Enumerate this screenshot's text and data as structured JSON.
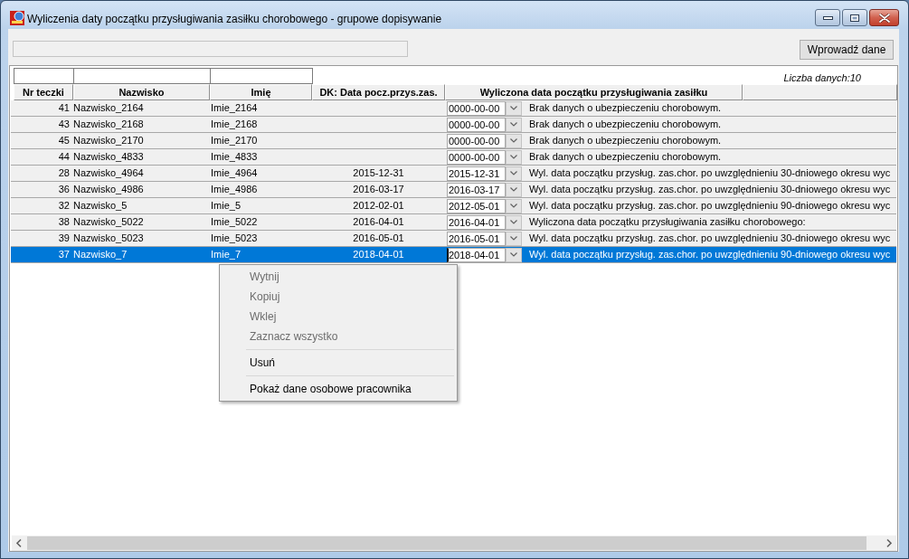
{
  "window": {
    "title": "Wyliczenia daty początku przysługiwania zasiłku chorobowego - grupowe dopisywanie"
  },
  "toolbar": {
    "enter_button": "Wprowadź dane"
  },
  "grid": {
    "count_label": "Liczba danych:10",
    "columns": [
      "Nr teczki",
      "Nazwisko",
      "Imię",
      "DK: Data pocz.przys.zas.",
      "Wyliczona data początku przysługiwania zasiłku"
    ],
    "rows": [
      {
        "nr_teczki": "41",
        "nazwisko": "Nazwisko_2164",
        "imie": "Imie_2164",
        "calculated_date": "0000-00-00",
        "description": "Brak danych o ubezpieczeniu chorobowym.",
        "selected": false
      },
      {
        "nr_teczki": "43",
        "nazwisko": "Nazwisko_2168",
        "imie": "Imie_2168",
        "calculated_date": "0000-00-00",
        "description": "Brak danych o ubezpieczeniu chorobowym.",
        "selected": false
      },
      {
        "nr_teczki": "45",
        "nazwisko": "Nazwisko_2170",
        "imie": "Imie_2170",
        "calculated_date": "0000-00-00",
        "description": "Brak danych o ubezpieczeniu chorobowym.",
        "selected": false
      },
      {
        "nr_teczki": "44",
        "nazwisko": "Nazwisko_4833",
        "imie": "Imie_4833",
        "calculated_date": "0000-00-00",
        "description": "Brak danych o ubezpieczeniu chorobowym.",
        "selected": false
      },
      {
        "nr_teczki": "28",
        "nazwisko": "Nazwisko_4964",
        "imie": "Imie_4964",
        "dk_date": "2015-12-31",
        "calculated_date": "2015-12-31",
        "description": "Wyl. data początku przysług. zas.chor. po uwzględnieniu 30-dniowego okresu wyc",
        "selected": false
      },
      {
        "nr_teczki": "36",
        "nazwisko": "Nazwisko_4986",
        "imie": "Imie_4986",
        "dk_date": "2016-03-17",
        "calculated_date": "2016-03-17",
        "description": "Wyl. data początku przysług. zas.chor. po uwzględnieniu 30-dniowego okresu wyc",
        "selected": false
      },
      {
        "nr_teczki": "32",
        "nazwisko": "Nazwisko_5",
        "imie": "Imie_5",
        "dk_date": "2012-02-01",
        "calculated_date": "2012-05-01",
        "description": "Wyl. data początku przysług. zas.chor. po uwzględnieniu 90-dniowego okresu wyc",
        "selected": false
      },
      {
        "nr_teczki": "38",
        "nazwisko": "Nazwisko_5022",
        "imie": "Imie_5022",
        "dk_date": "2016-04-01",
        "calculated_date": "2016-04-01",
        "description": "Wyliczona data początku przysługiwania zasiłku chorobowego:",
        "selected": false
      },
      {
        "nr_teczki": "39",
        "nazwisko": "Nazwisko_5023",
        "imie": "Imie_5023",
        "dk_date": "2016-05-01",
        "calculated_date": "2016-05-01",
        "description": "Wyl. data początku przysług. zas.chor. po uwzględnieniu 30-dniowego okresu wyc",
        "selected": false
      },
      {
        "nr_teczki": "37",
        "nazwisko": "Nazwisko_7",
        "imie": "Imie_7",
        "dk_date": "2018-04-01",
        "calculated_date": "2018-04-01",
        "description": "Wyl. data początku przysług. zas.chor. po uwzględnieniu 90-dniowego okresu wyc",
        "selected": true
      }
    ]
  },
  "context_menu": {
    "items": [
      {
        "kind": "item",
        "label": "Wytnij",
        "disabled": true
      },
      {
        "kind": "item",
        "label": "Kopiuj",
        "disabled": true
      },
      {
        "kind": "item",
        "label": "Wklej",
        "disabled": true
      },
      {
        "kind": "item",
        "label": "Zaznacz wszystko",
        "disabled": true
      },
      {
        "kind": "separator"
      },
      {
        "kind": "item",
        "label": "Usuń",
        "disabled": false
      },
      {
        "kind": "separator"
      },
      {
        "kind": "item",
        "label": "Pokaż dane osobowe pracownika",
        "disabled": false
      }
    ]
  }
}
